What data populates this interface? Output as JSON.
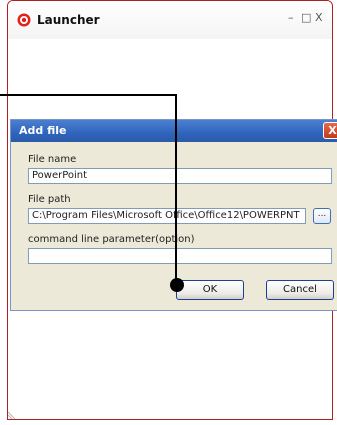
{
  "launcher": {
    "title": "Launcher",
    "controls": {
      "minimize": "–",
      "maximize": "□",
      "close": "X"
    }
  },
  "dialog": {
    "title": "Add file",
    "close_label": "X",
    "file_name": {
      "label": "File name",
      "value": "PowerPoint"
    },
    "file_path": {
      "label": "File path",
      "value": "C:\\Program Files\\Microsoft Office\\Office12\\POWERPNT",
      "browse_label": "..."
    },
    "command_line": {
      "label": "command line parameter(option)",
      "value": ""
    },
    "ok_label": "OK",
    "cancel_label": "Cancel"
  },
  "colors": {
    "dialog_bg": "#ece9d8",
    "titlebar_blue": "#2f64bc",
    "launcher_logo_red": "#e0201b",
    "pointer": "#000000"
  }
}
